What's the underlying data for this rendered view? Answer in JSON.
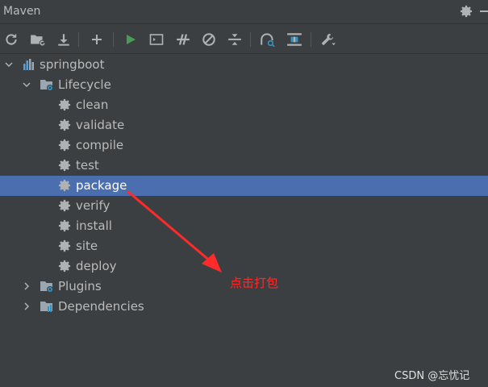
{
  "window": {
    "title": "Maven"
  },
  "toolbar": {
    "icons": [
      "reload-icon",
      "generate-sources-icon",
      "download-icon",
      "add-icon",
      "run-icon",
      "execute-goal-icon",
      "toggle-offline-icon",
      "skip-tests-icon",
      "collapse-all-icon",
      "analyze-dependencies-icon",
      "show-diagram-icon",
      "settings-wrench-icon"
    ]
  },
  "tree": {
    "project": "springboot",
    "lifecycle": {
      "label": "Lifecycle",
      "goals": [
        "clean",
        "validate",
        "compile",
        "test",
        "package",
        "verify",
        "install",
        "site",
        "deploy"
      ],
      "selected": "package"
    },
    "plugins": "Plugins",
    "dependencies": "Dependencies"
  },
  "annotation": {
    "text": "点击打包",
    "color": "#ff2a2a"
  },
  "watermark": "CSDN @忘忧记",
  "colors": {
    "background": "#3c3f41",
    "selection": "#4b6eaf",
    "run_green": "#499c54",
    "accent_blue": "#3592c4"
  }
}
